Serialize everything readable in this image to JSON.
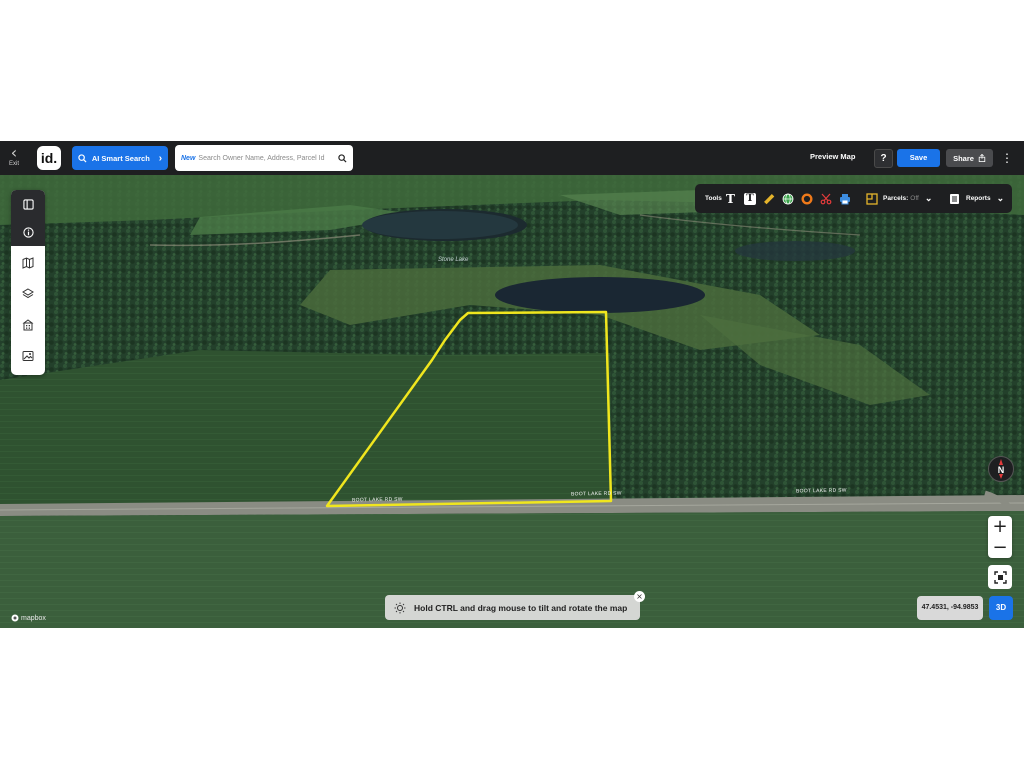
{
  "topbar": {
    "exit_label": "Exit",
    "logo_text": "id.",
    "ai_search_label": "AI Smart Search",
    "search_new_badge": "New",
    "search_placeholder": "Search Owner Name, Address, Parcel Id",
    "preview_map_label": "Preview Map",
    "help_label": "?",
    "save_label": "Save",
    "share_label": "Share"
  },
  "tools": {
    "tools_label": "Tools",
    "parcels_label": "Parcels:",
    "parcels_state": "Off",
    "reports_label": "Reports"
  },
  "map": {
    "lake_label": "Stone Lake",
    "road_labels": [
      "BOOT LAKE RD SW",
      "BOOT LAKE RD SW",
      "BOOT LAKE RD SW"
    ],
    "compass_label": "N",
    "zoom_in": "+",
    "zoom_out": "−",
    "coordinates": "47.4531, -94.9853",
    "mode_3d": "3D",
    "hint_text": "Hold CTRL and drag mouse to tilt and rotate the map",
    "attribution": "mapbox",
    "parcel_color": "#f0e61e"
  },
  "left_panel": {
    "items": [
      "panel-icon",
      "info-icon",
      "map-icon",
      "layers-icon",
      "buildings-icon",
      "image-icon"
    ]
  },
  "colors": {
    "accent": "#1a73e8",
    "topbar": "#1e1f21"
  }
}
